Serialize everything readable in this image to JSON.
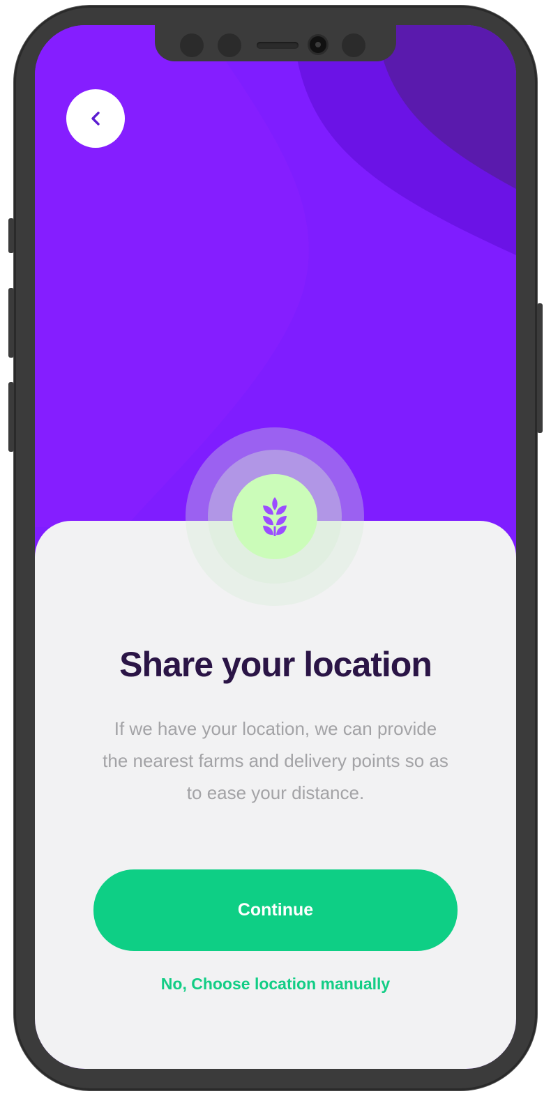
{
  "screen": {
    "back_icon": "chevron-left-icon",
    "brand_icon": "wheat-icon",
    "title": "Share your location",
    "description": "If we have your location, we can provide the nearest farms and delivery points so as to ease your distance.",
    "continue_label": "Continue",
    "manual_link_label": "No, Choose location manually"
  },
  "colors": {
    "header_purple": "#7f1dff",
    "card_background": "#f2f2f3",
    "accent_green": "#0ecf85",
    "icon_badge_green": "#cbfcb9",
    "title_color": "#2b1546",
    "text_gray": "#a3a3a6"
  }
}
